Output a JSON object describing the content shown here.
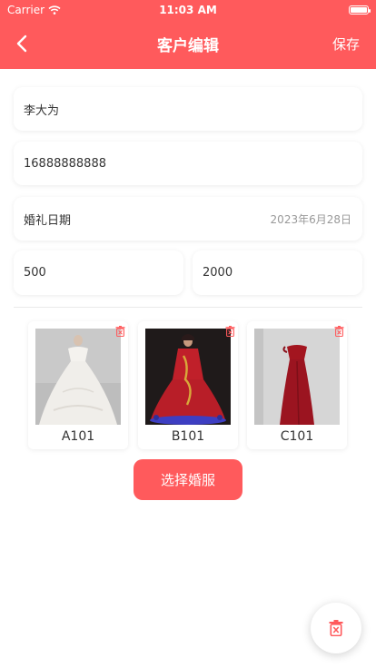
{
  "status_bar": {
    "carrier": "Carrier",
    "time": "11:03 AM"
  },
  "nav": {
    "title": "客户编辑",
    "save_label": "保存"
  },
  "form": {
    "name": "李大为",
    "phone": "16888888888",
    "wedding_label": "婚礼日期",
    "wedding_date": "2023年6月28日",
    "amount_1": "500",
    "amount_2": "2000"
  },
  "dresses": [
    {
      "code": "A101",
      "icon": "trash-icon"
    },
    {
      "code": "B101",
      "icon": "trash-icon"
    },
    {
      "code": "C101",
      "icon": "trash-icon"
    }
  ],
  "select_button_label": "选择婚服",
  "colors": {
    "accent": "#ff5a5c",
    "card_bg": "#ffffff",
    "muted_text": "#999999"
  }
}
